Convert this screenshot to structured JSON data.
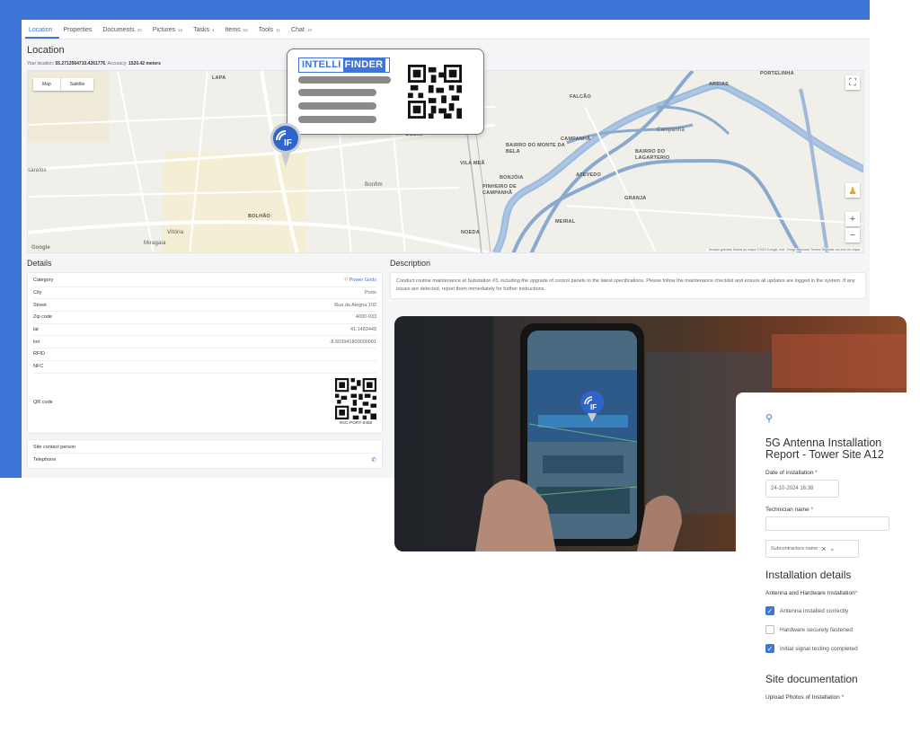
{
  "tabs": [
    {
      "label": "Location",
      "count": "",
      "active": true
    },
    {
      "label": "Properties",
      "count": ""
    },
    {
      "label": "Documents",
      "count": "33"
    },
    {
      "label": "Pictures",
      "count": "15"
    },
    {
      "label": "Tasks",
      "count": "4"
    },
    {
      "label": "Items",
      "count": "53"
    },
    {
      "label": "Tools",
      "count": "41"
    },
    {
      "label": "Chat",
      "count": "19"
    }
  ],
  "location": {
    "title": "Location",
    "your_location_label": "Your location:",
    "coords": "55.2713564710.4261776",
    "accuracy_label": ", Accuracy:",
    "accuracy": "1520.42 meters"
  },
  "map": {
    "type_map": "Map",
    "type_satellite": "Satélite",
    "fullscreen_icon": "fullscreen-icon",
    "zoom_in": "+",
    "zoom_out": "−",
    "google": "Google",
    "attribution": "Teclado gravado   Dados do mapa ©2024 Google, Inst. Geogr. Nacional   Termos   Reportar um erro no mapa",
    "places": [
      "LAPA",
      "GODIM",
      "FALCÃO",
      "AREIAS",
      "PORTELINHA",
      "Campanhã",
      "CAMPANHÃ",
      "BAIRRO DO MONTE DA BELA",
      "BAIRRO DO LAGARTERIO",
      "VILA MEÃ",
      "AZEVEDO",
      "BONJÓIA",
      "PINHEIRO DE CAMPANHÃ",
      "Bonfim",
      "BOLHÃO",
      "Vitória",
      "Miragaia",
      "GRANJA",
      "MEIRAL",
      "NOEDA",
      "sarelos"
    ]
  },
  "details": {
    "title": "Details",
    "rows": [
      {
        "key": "Category",
        "value": "Power Grids",
        "link": true
      },
      {
        "key": "City",
        "value": "Porto"
      },
      {
        "key": "Street",
        "value": "Rua da Alegria 102"
      },
      {
        "key": "Zip code",
        "value": "4000-033"
      },
      {
        "key": "lat",
        "value": "41.1483449"
      },
      {
        "key": "lon",
        "value": "-8.603941800000001"
      },
      {
        "key": "RFID",
        "value": ""
      },
      {
        "key": "NFC",
        "value": ""
      }
    ],
    "qr_label": "QR code",
    "qr_id": "#GC-PORT-0456",
    "contact_label": "Site contact person",
    "telephone_label": "Telephone"
  },
  "description": {
    "title": "Description",
    "text": "Conduct routine maintenance at Substation #3, including the upgrade of control panels to the latest specifications. Please follow the maintenance checklist and ensure all updates are logged in the system. If any issues are detected, report them immediately for further instructions."
  },
  "intellifinder": {
    "logo_a": "INTELLI",
    "logo_b": "FINDER"
  },
  "form": {
    "title": "5G Antenna Installation Report - Tower Site A12",
    "date_label": "Date of installation",
    "date_value": "24-10-2024 16:38",
    "technician_label": "Technician name",
    "technician_value": "",
    "subcontractor_placeholder": "Subcontractors name",
    "section_install": "Installation details",
    "antenna_label": "Antenna and Hardware Installation",
    "checks": [
      {
        "label": "Antenna installed correctly",
        "checked": true
      },
      {
        "label": "Hardware securely fastened",
        "checked": false
      },
      {
        "label": "Initial signal testing completed",
        "checked": true
      }
    ],
    "section_docs": "Site documentation",
    "upload_label": "Upload Photos of Installation",
    "required_mark": "*"
  },
  "colors": {
    "accent": "#3f74d9"
  }
}
